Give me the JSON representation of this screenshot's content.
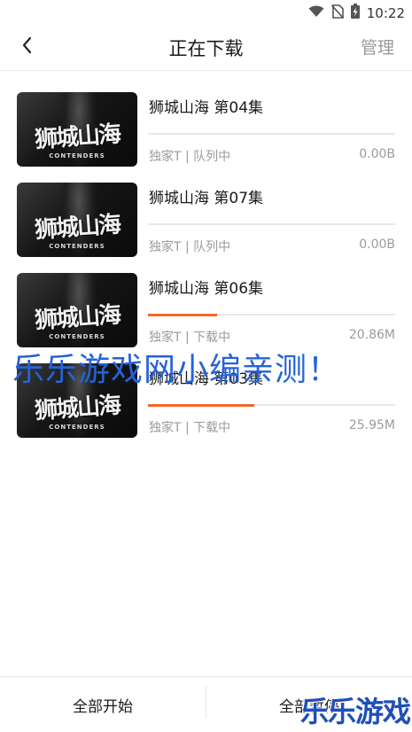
{
  "status_bar": {
    "time": "10:22",
    "icons": [
      "wifi-icon",
      "no-sim-icon",
      "battery-charging-icon"
    ]
  },
  "header": {
    "title": "正在下载",
    "manage_label": "管理",
    "back_icon": "chevron-left-icon"
  },
  "downloads": [
    {
      "title": "狮城山海 第04集",
      "status": "独家T | 队列中",
      "size": "0.00B",
      "progress": 0
    },
    {
      "title": "狮城山海 第07集",
      "status": "独家T | 队列中",
      "size": "0.00B",
      "progress": 0
    },
    {
      "title": "狮城山海 第06集",
      "status": "独家T | 下载中",
      "size": "20.86M",
      "progress": 0.28
    },
    {
      "title": "狮城山海 第03集",
      "status": "独家T | 下载中",
      "size": "25.95M",
      "progress": 0.43
    }
  ],
  "thumbnail": {
    "title": "狮城山海",
    "subtitle": "CONTENDERS"
  },
  "watermark": "乐乐游戏网小编亲测！",
  "bottom_bar": {
    "start_all": "全部开始",
    "pause_all": "全部暂停"
  },
  "corner_logo": "乐乐游戏",
  "colors": {
    "accent": "#f0692a",
    "watermark": "#2563d9",
    "secondary_text": "#9b9b9b"
  }
}
